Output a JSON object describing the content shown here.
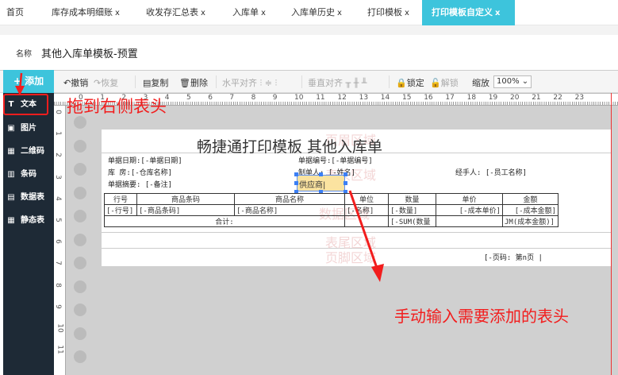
{
  "tabs": [
    {
      "label": "首页"
    },
    {
      "label": "库存成本明细账",
      "close": "x"
    },
    {
      "label": "收发存汇总表",
      "close": "x"
    },
    {
      "label": "入库单",
      "close": "x"
    },
    {
      "label": "入库单历史",
      "close": "x"
    },
    {
      "label": "打印模板",
      "close": "x"
    },
    {
      "label": "打印模板自定义",
      "close": "x",
      "active": true
    }
  ],
  "name": {
    "label": "名称",
    "value": "其他入库单模板-预置"
  },
  "toolbar": {
    "add": "添加",
    "undo": "撤销",
    "redo": "恢复",
    "copy": "复制",
    "delete": "删除",
    "halign": "水平对齐",
    "valign": "垂直对齐",
    "lock": "锁定",
    "unlock": "解锁",
    "zoom_label": "缩放",
    "zoom_value": "100%"
  },
  "sidebar": {
    "items": [
      {
        "label": "文本",
        "icon": "text-icon"
      },
      {
        "label": "图片",
        "icon": "image-icon"
      },
      {
        "label": "二维码",
        "icon": "qrcode-icon"
      },
      {
        "label": "条码",
        "icon": "barcode-icon"
      },
      {
        "label": "数据表",
        "icon": "data-table-icon"
      },
      {
        "label": "静态表",
        "icon": "static-table-icon"
      }
    ]
  },
  "ruler": {
    "h": [
      "0",
      "1",
      "2",
      "3",
      "4",
      "5",
      "6",
      "7",
      "8",
      "9",
      "10",
      "11",
      "12",
      "13",
      "14",
      "15",
      "16",
      "17",
      "18",
      "19",
      "20",
      "21",
      "22",
      "23"
    ],
    "v": [
      "0",
      "1",
      "2",
      "3",
      "4",
      "5",
      "6",
      "7",
      "8",
      "9",
      "10",
      "11"
    ]
  },
  "document": {
    "title": "畅捷通打印模板  其他入库单",
    "fields": {
      "date": "单据日期:[-单据日期]",
      "number": "单据编号:[-单据编号]",
      "warehouse": "库     房:[-仓库名称]",
      "maker": "制单人: [-姓名]",
      "handler": "经手人: [-员工名称]",
      "memo": "单据摘要: [-备注]"
    },
    "editing_text": "供应商",
    "table": {
      "headers": [
        "行号",
        "商品条码",
        "商品名称",
        "单位",
        "数量",
        "单价",
        "金额"
      ],
      "row": [
        "[-行号]",
        "[-商品条码]",
        "[-商品名称]",
        "[-名称]",
        "[-数量]",
        "[-成本单价]",
        "[-成本金额]"
      ],
      "total_label": "合计:",
      "total_qty": "[-SUM(数量",
      "total_amount": "JM(成本金额)]"
    },
    "page_no": "[-页码: 第n页 |",
    "watermarks": [
      "页眉区域",
      "表头区域",
      "数据区域",
      "表尾区域",
      "页脚区域"
    ]
  },
  "annotations": {
    "drag": "拖到右侧表头",
    "input": "手动输入需要添加的表头",
    "color": "#f21d1d"
  },
  "colors": {
    "accent": "#3dc4dc",
    "sidebar": "#1e2a36"
  }
}
